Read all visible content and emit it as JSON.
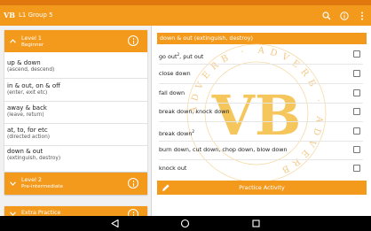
{
  "app": {
    "logo": "VB",
    "title": "L1 Group 5"
  },
  "colors": {
    "accent": "#f39a1d",
    "status_bar": "#e0780d"
  },
  "icons": {
    "search": "search-icon",
    "info": "info-icon",
    "more": "more-vert-icon",
    "chevron_up": "chevron-up-icon",
    "chevron_down": "chevron-down-icon",
    "pencil": "pencil-icon",
    "back": "back-icon",
    "home": "home-icon",
    "recents": "recents-icon"
  },
  "levels": [
    {
      "title": "Level 1",
      "subtitle": "Beginner",
      "expanded": true,
      "topics": [
        {
          "title": "up & down",
          "sub": "(ascend, descend)"
        },
        {
          "title": "in & out, on & off",
          "sub": "(enter, exit etc)"
        },
        {
          "title": "away & back",
          "sub": "(leave, return)"
        },
        {
          "title": "at, to, for etc",
          "sub": "(directed action)"
        },
        {
          "title": "down & out",
          "sub": "(extinguish, destroy)"
        }
      ]
    },
    {
      "title": "Level 2",
      "subtitle": "Pre-intermediate",
      "expanded": false
    },
    {
      "title": "Extra Practice",
      "expanded": false
    }
  ],
  "detail": {
    "header": "down & out (extinguish, destroy)",
    "rows": [
      {
        "text": "go out",
        "sup": "2",
        "rest": ", put out",
        "checked": false
      },
      {
        "text": "close down",
        "sup": "",
        "rest": "",
        "checked": false
      },
      {
        "text": "fall down",
        "sup": "",
        "rest": "",
        "checked": false
      },
      {
        "text": "break down, knock down",
        "sup": "",
        "rest": "",
        "checked": false
      },
      {
        "text": "break down",
        "sup": "2",
        "rest": "",
        "checked": false
      },
      {
        "text": "burn down, cut down, chop down, blow down",
        "sup": "",
        "rest": "",
        "checked": false
      },
      {
        "text": "knock out",
        "sup": "",
        "rest": "",
        "checked": false
      }
    ],
    "practice_label": "Practice Activity"
  },
  "watermark": {
    "letters": "VB",
    "ring_text": "ADVERB · ADVERB · ADVERB"
  }
}
